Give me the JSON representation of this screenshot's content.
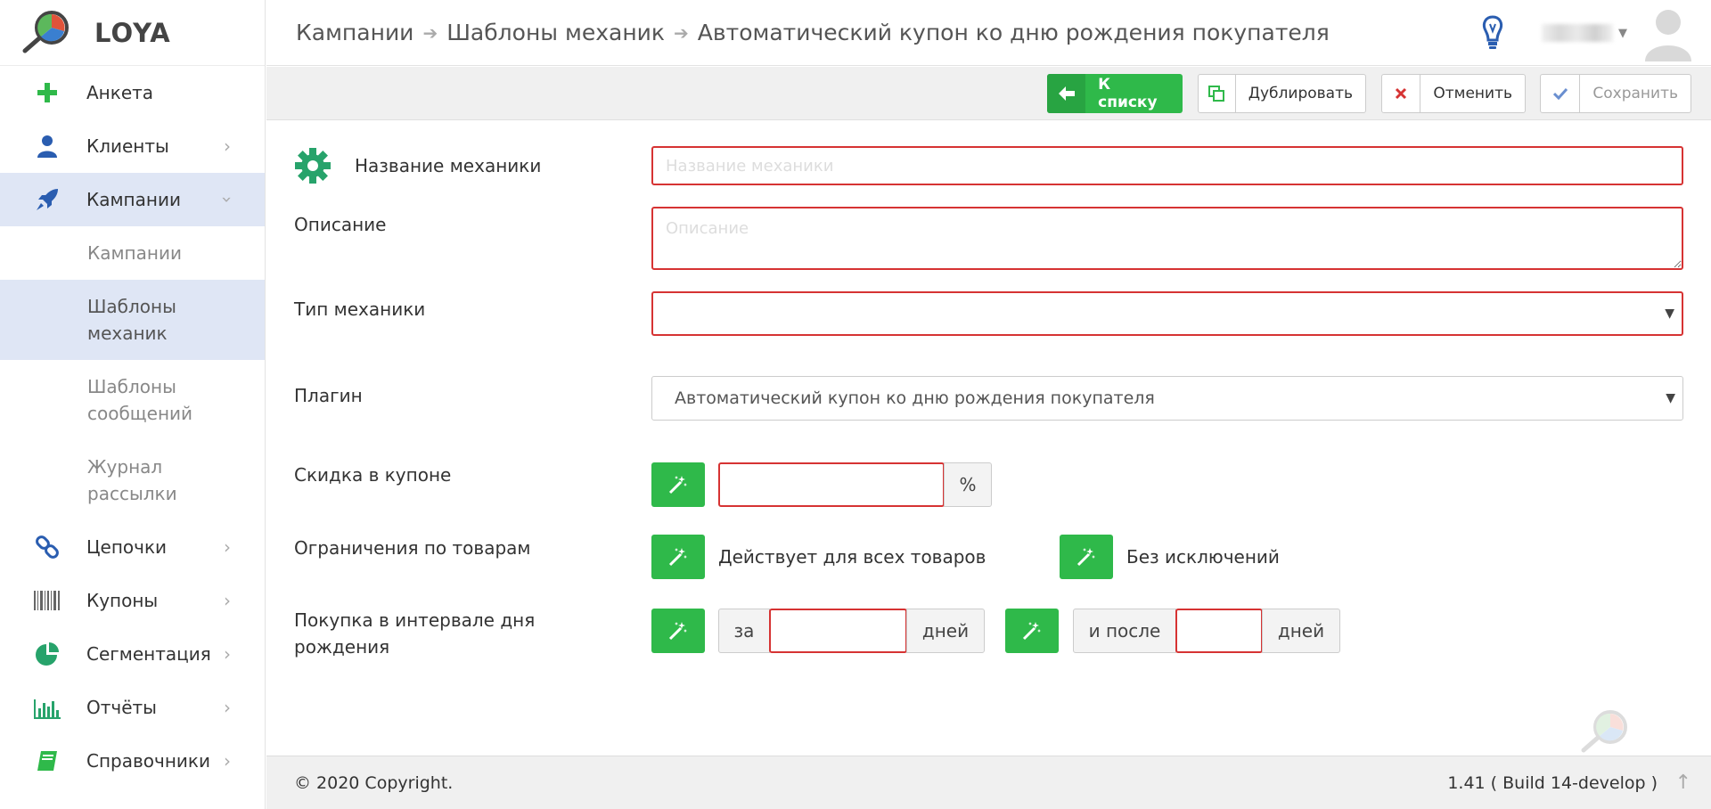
{
  "app": {
    "name": "LOYA"
  },
  "breadcrumbs": [
    "Кампании",
    "Шаблоны механик",
    "Автоматический купон ко дню рождения покупателя"
  ],
  "sidebar": {
    "items": [
      {
        "label": "Анкета",
        "icon": "plus-icon"
      },
      {
        "label": "Клиенты",
        "icon": "user-icon"
      },
      {
        "label": "Кампании",
        "icon": "rocket-icon",
        "expanded": true
      },
      {
        "label": "Цепочки",
        "icon": "chain-icon"
      },
      {
        "label": "Купоны",
        "icon": "barcode-icon"
      },
      {
        "label": "Сегментация",
        "icon": "pie-chart-icon"
      },
      {
        "label": "Отчёты",
        "icon": "bar-chart-icon"
      },
      {
        "label": "Справочники",
        "icon": "book-icon"
      }
    ],
    "subitems": [
      {
        "label": "Кампании"
      },
      {
        "label": "Шаблоны механик",
        "active": true
      },
      {
        "label": "Шаблоны сообщений"
      },
      {
        "label": "Журнал рассылки"
      }
    ]
  },
  "toolbar": {
    "back_label": "К списку",
    "duplicate_label": "Дублировать",
    "cancel_label": "Отменить",
    "save_label": "Сохранить"
  },
  "form": {
    "name_label": "Название механики",
    "name_placeholder": "Название механики",
    "name_value": "",
    "description_label": "Описание",
    "description_placeholder": "Описание",
    "type_label": "Тип механики",
    "type_value": "",
    "plugin_label": "Плагин",
    "plugin_value": "Автоматический купон ко дню рождения покупателя",
    "discount_label": "Скидка в купоне",
    "discount_value": "",
    "discount_unit": "%",
    "restrictions_label": "Ограничения по товарам",
    "restriction_goods": "Действует для всех товаров",
    "restriction_exceptions": "Без исключений",
    "interval_label": "Покупка в интервале дня рождения",
    "interval_before_prefix": "за",
    "interval_before_value": "",
    "interval_before_suffix": "дней",
    "interval_after_prefix": "и после",
    "interval_after_value": "",
    "interval_after_suffix": "дней"
  },
  "footer": {
    "copyright": "© 2020 Copyright.",
    "build": "1.41 ( Build 14-develop )"
  },
  "colors": {
    "accent_green": "#2fb94a",
    "error_red": "#d63333",
    "active_bg": "#dfe6f5",
    "brand_blue": "#2a5db0"
  }
}
